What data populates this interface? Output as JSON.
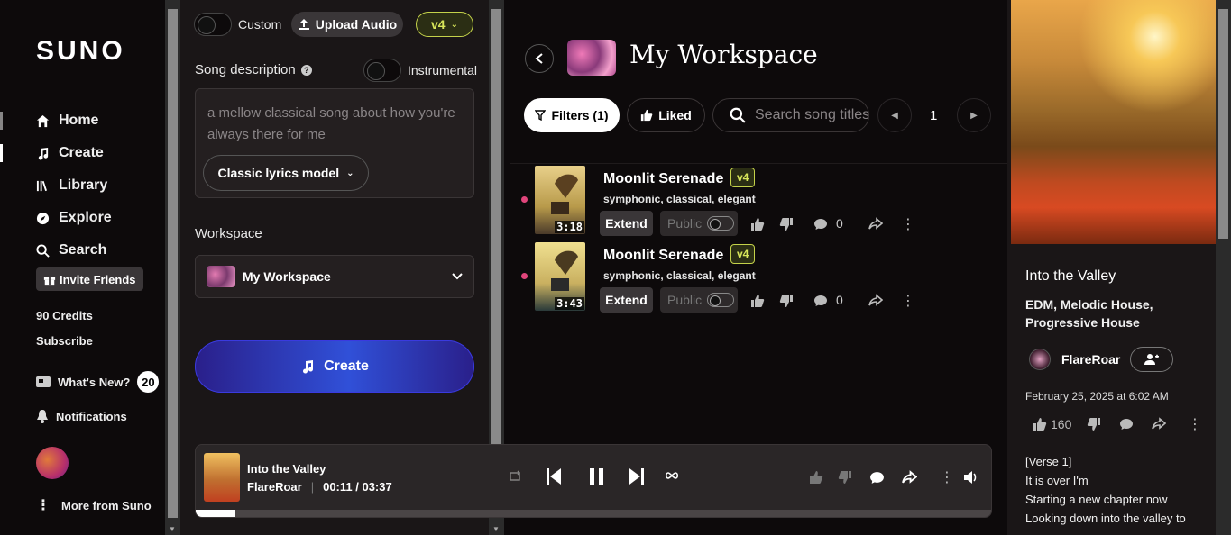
{
  "sidebar": {
    "logo": "SUNO",
    "nav": [
      {
        "label": "Home",
        "icon": "home-icon"
      },
      {
        "label": "Create",
        "icon": "music-note-icon"
      },
      {
        "label": "Library",
        "icon": "library-icon"
      },
      {
        "label": "Explore",
        "icon": "compass-icon"
      },
      {
        "label": "Search",
        "icon": "search-icon"
      }
    ],
    "invite_label": "Invite Friends",
    "credits": "90 Credits",
    "subscribe": "Subscribe",
    "whats_new": "What's New?",
    "whats_new_count": "20",
    "notifications": "Notifications",
    "more": "More from Suno"
  },
  "create_panel": {
    "custom_label": "Custom",
    "upload_label": "Upload Audio",
    "version": "v4",
    "song_description_label": "Song description",
    "instrumental_label": "Instrumental",
    "description_placeholder": "a mellow classical song about how you're always there for me",
    "lyrics_model": "Classic lyrics model",
    "workspace_label": "Workspace",
    "workspace_value": "My Workspace",
    "create_label": "Create"
  },
  "workspace": {
    "title": "My Workspace",
    "filters_label": "Filters (1)",
    "liked_label": "Liked",
    "search_placeholder": "Search song titles",
    "page": "1",
    "songs": [
      {
        "title": "Moonlit Serenade",
        "version": "v4",
        "tags": "symphonic, classical, elegant",
        "duration": "3:18",
        "extend": "Extend",
        "public": "Public",
        "comments": "0"
      },
      {
        "title": "Moonlit Serenade",
        "version": "v4",
        "tags": "symphonic, classical, elegant",
        "duration": "3:43",
        "extend": "Extend",
        "public": "Public",
        "comments": "0"
      }
    ]
  },
  "right_panel": {
    "title": "Into the Valley",
    "genre": "EDM, Melodic House, Progressive House",
    "user": "FlareRoar",
    "date": "February 25, 2025 at 6:02 AM",
    "likes": "160",
    "lyrics": [
      "[Verse 1]",
      "It is over I'm",
      "Starting a new chapter now",
      "Looking down into the valley to"
    ]
  },
  "player": {
    "title": "Into the Valley",
    "artist": "FlareRoar",
    "time": "00:11 / 03:37",
    "progress": 0.05
  }
}
